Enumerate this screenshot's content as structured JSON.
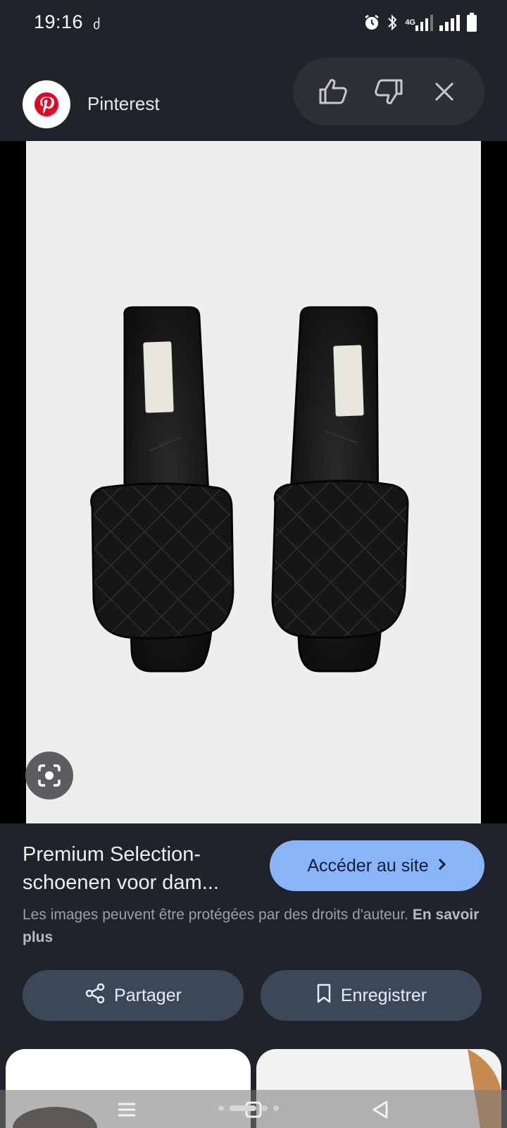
{
  "status_bar": {
    "time": "19:16",
    "notification_glyph": "ძ",
    "network": "4G"
  },
  "header": {
    "source_name": "Pinterest"
  },
  "result": {
    "title": "Premium Selection-schoenen voor dam...",
    "visit_label": "Accéder au site",
    "copyright_text": "Les images peuvent être protégées par des droits d'auteur.",
    "learn_more": "En savoir plus"
  },
  "actions": {
    "share_label": "Partager",
    "save_label": "Enregistrer"
  },
  "colors": {
    "background": "#202329",
    "accent": "#8ab4f8",
    "action_button": "#3c4759",
    "pinterest_red": "#e60023"
  },
  "icons": [
    "alarm-icon",
    "bluetooth-icon",
    "signal-icon",
    "battery-icon",
    "pinterest-logo-icon",
    "thumbs-up-icon",
    "thumbs-down-icon",
    "close-icon",
    "lens-icon",
    "chevron-right-icon",
    "share-icon",
    "bookmark-icon",
    "recents-icon",
    "home-icon",
    "back-icon"
  ]
}
